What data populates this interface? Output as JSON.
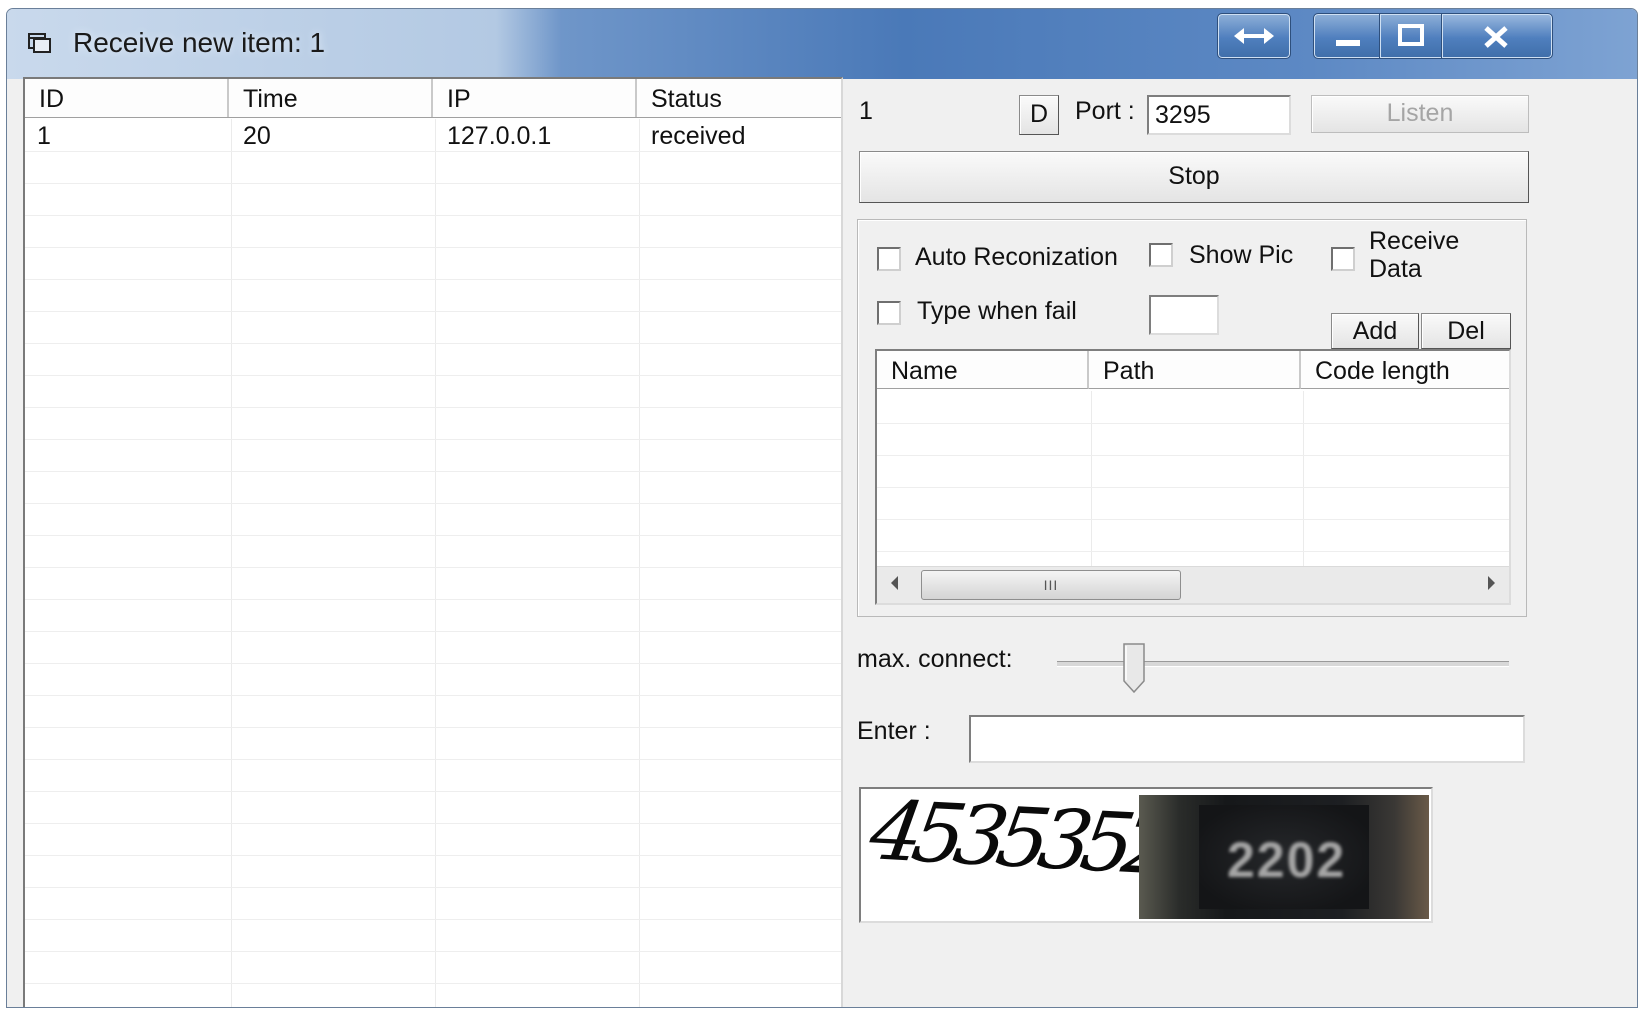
{
  "window": {
    "title": "Receive new item: 1",
    "controls": {
      "resize_icon": "double-arrow-icon",
      "minimize_icon": "minimize-icon",
      "maximize_icon": "maximize-icon",
      "close_icon": "close-icon"
    }
  },
  "received_list": {
    "columns": [
      "ID",
      "Time",
      "IP",
      "Status"
    ],
    "rows": [
      {
        "id": "1",
        "time": "20",
        "ip": "127.0.0.1",
        "status": "received"
      }
    ]
  },
  "connection": {
    "count": "1",
    "d_button": "D",
    "port_label": "Port :",
    "port_value": "3295",
    "listen_button": "Listen",
    "listen_enabled": false,
    "stop_button": "Stop"
  },
  "options": {
    "auto_recognization": {
      "label": "Auto Reconization",
      "checked": false
    },
    "show_pic": {
      "label": "Show Pic",
      "checked": false
    },
    "receive_data": {
      "label": "Receive Data",
      "checked": false
    },
    "type_when_fail": {
      "label": "Type when fail",
      "checked": false
    },
    "type_when_fail_value": "",
    "add_button": "Add",
    "del_button": "Del"
  },
  "dictionary_list": {
    "columns": [
      "Name",
      "Path",
      "Code length"
    ],
    "scrollbar_thumb_glyph": "III"
  },
  "max_connect": {
    "label": "max. connect:",
    "level": 0.17
  },
  "enter": {
    "label": "Enter :",
    "value": ""
  },
  "captcha": {
    "text": "4535352",
    "photo_text": "2202"
  }
}
